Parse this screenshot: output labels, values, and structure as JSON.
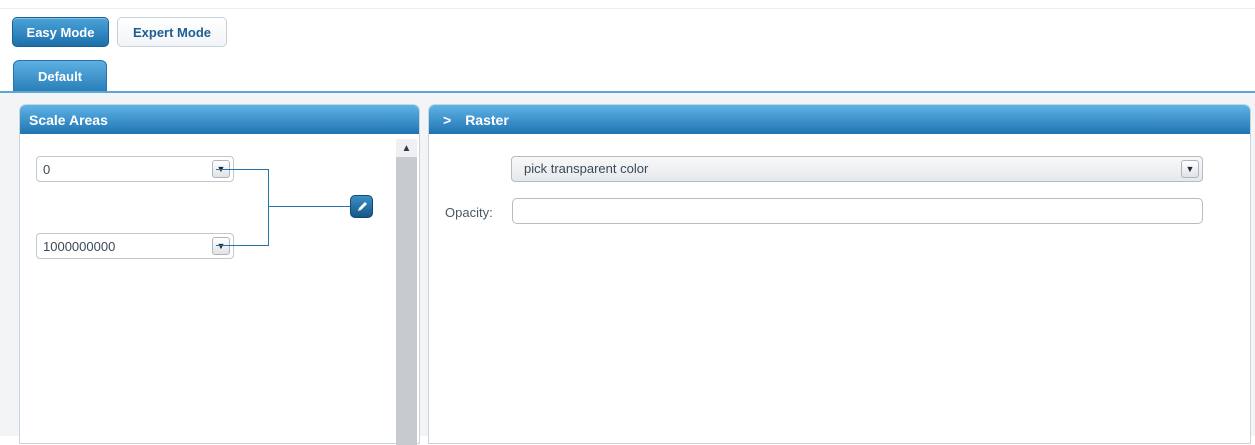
{
  "modes": {
    "easy_label": "Easy Mode",
    "expert_label": "Expert Mode",
    "active": "easy"
  },
  "tabs": [
    {
      "label": "Default"
    }
  ],
  "scale_areas": {
    "title": "Scale Areas",
    "min_value": "0",
    "max_value": "1000000000"
  },
  "raster": {
    "title": "Raster",
    "header_arrow": ">",
    "transparent_color_label": "pick transparent color",
    "opacity_label": "Opacity:",
    "opacity_value": ""
  },
  "icons": {
    "dropdown": "dropdown-arrow-icon",
    "scroll_up": "scroll-up-arrow-icon",
    "edit": "pencil-icon"
  },
  "colors": {
    "accent": "#1f74b2",
    "tab_line": "#5ea7d4",
    "connector": "#2774ad",
    "background": "#f2f4f6"
  }
}
